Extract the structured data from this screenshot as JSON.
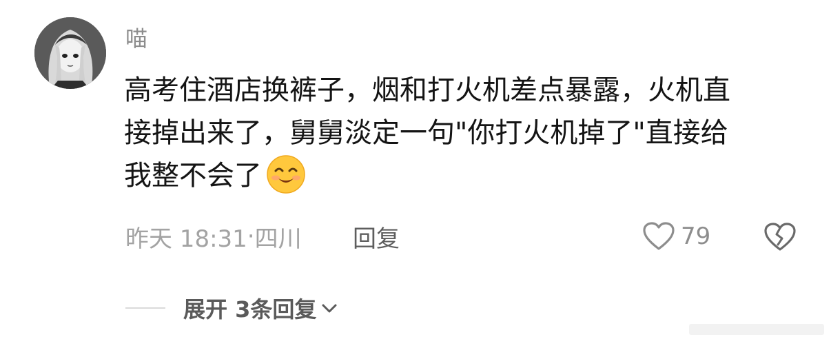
{
  "comment": {
    "username": "喵",
    "avatar_icon": "anime-girl-avatar",
    "content_lines": [
      "高考住酒店换裤子，烟和打火机差点暴露，火机直",
      "接掉出来了，舅舅淡定一句\"你打火机掉了\"直接给",
      "我整不会了"
    ],
    "emoji": "smiling-face-emoji",
    "time": "昨天 18:31",
    "separator": "·",
    "location": "四川",
    "reply_label": "回复",
    "like_count": "79",
    "expand_label": "展开 3条回复"
  },
  "colors": {
    "text": "#141414",
    "muted": "#a3a3a3",
    "username": "#8d8d8d"
  }
}
